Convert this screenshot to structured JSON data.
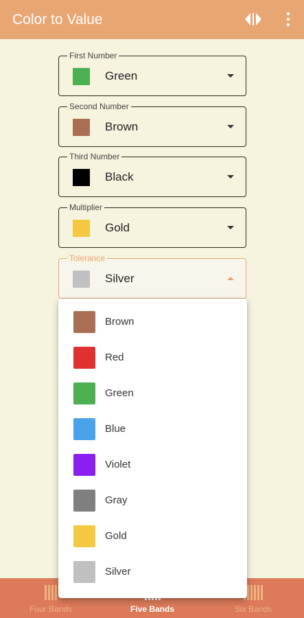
{
  "appbar": {
    "title": "Color to Value",
    "swap_icon": "swap-arrows-icon",
    "more_icon": "more-vert-icon"
  },
  "fields": [
    {
      "legend": "First Number",
      "value": "Green",
      "color": "#4caf50"
    },
    {
      "legend": "Second Number",
      "value": "Brown",
      "color": "#a86f55"
    },
    {
      "legend": "Third Number",
      "value": "Black",
      "color": "#000000"
    },
    {
      "legend": "Multiplier",
      "value": "Gold",
      "color": "#f5c842"
    },
    {
      "legend": "Tolerance",
      "value": "Silver",
      "color": "#c0c0c0",
      "active": true
    }
  ],
  "dropdown": {
    "options": [
      {
        "label": "Brown",
        "color": "#a86f55"
      },
      {
        "label": "Red",
        "color": "#e03030"
      },
      {
        "label": "Green",
        "color": "#4caf50"
      },
      {
        "label": "Blue",
        "color": "#4aa3e8"
      },
      {
        "label": "Violet",
        "color": "#8a1ff0"
      },
      {
        "label": "Gray",
        "color": "#7f7f7f"
      },
      {
        "label": "Gold",
        "color": "#f5c842"
      },
      {
        "label": "Silver",
        "color": "#c0c0c0"
      }
    ]
  },
  "bottom_nav": {
    "items": [
      {
        "label": "Four Bands",
        "icon": "resistor-bands-icon"
      },
      {
        "label": "Five Bands",
        "icon": "resistor-bands-icon",
        "selected": true
      },
      {
        "label": "Six Bands",
        "icon": "resistor-bands-icon"
      }
    ]
  },
  "colors": {
    "background": "#f6f3df",
    "appbar": "#e8a673",
    "bottom_nav": "#dc7a5a",
    "accent": "#e8a673"
  }
}
